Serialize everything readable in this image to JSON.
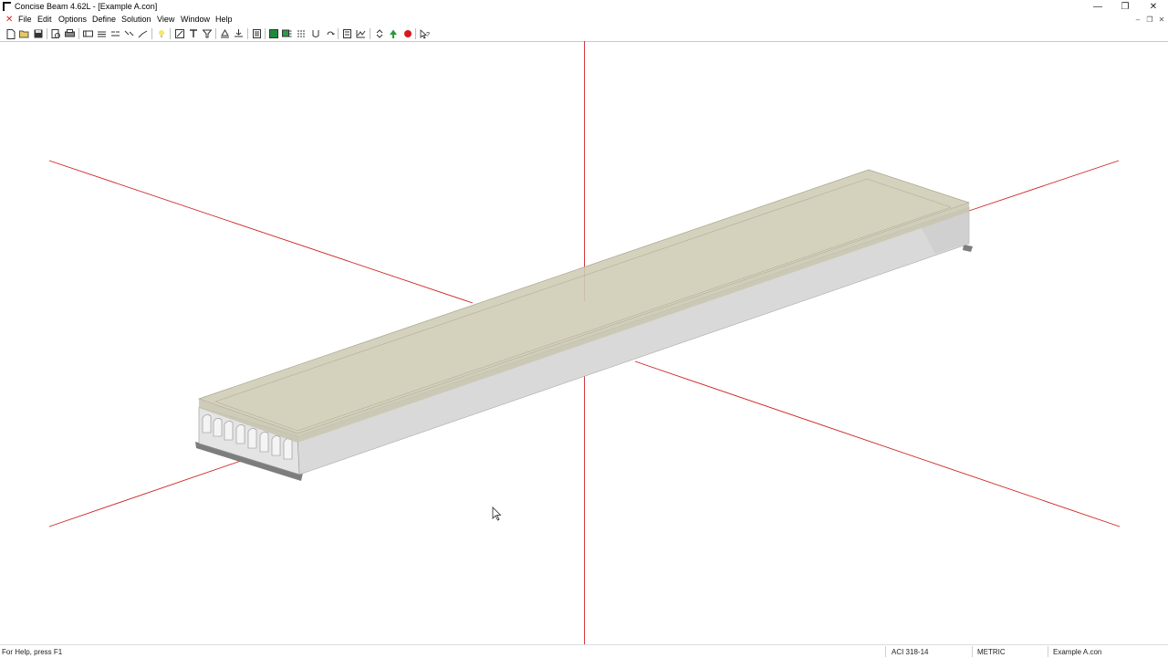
{
  "window": {
    "title": "Concise Beam 4.62L - [Example A.con]",
    "minimize_glyph": "—",
    "restore_glyph": "❐",
    "close_glyph": "✕"
  },
  "menu": {
    "items": [
      "File",
      "Edit",
      "Options",
      "Define",
      "Solution",
      "View",
      "Window",
      "Help"
    ]
  },
  "mdi_controls": {
    "close_glyph": "✕",
    "min_glyph": "–",
    "restore_glyph": "❐",
    "closechild_glyph": "✕"
  },
  "toolbar": {
    "icons": [
      "new-file-icon",
      "open-folder-icon",
      "save-icon",
      "print-preview-icon",
      "print-icon",
      "beam-section-icon",
      "cut-icon",
      "copy-icon",
      "paste-icon",
      "undo-icon",
      "lightbulb-icon",
      "select-icon",
      "text-icon",
      "filter-icon",
      "support-icon",
      "load-icon",
      "report-icon",
      "grid-icon",
      "layers-icon",
      "distribute-icon",
      "u-section-icon",
      "rotate-icon",
      "document-icon",
      "chart-icon",
      "recycle-icon",
      "tree-icon",
      "record-icon",
      "help-pointer-icon"
    ]
  },
  "statusbar": {
    "help_text": "For Help, press F1",
    "code": "ACI 318-14",
    "units": "METRIC",
    "file": "Example A.con"
  },
  "colors": {
    "axis": "#cc2222",
    "beam_top": "#cfccb6",
    "beam_side": "#d9d9d9",
    "support": "#7c7c7c"
  }
}
